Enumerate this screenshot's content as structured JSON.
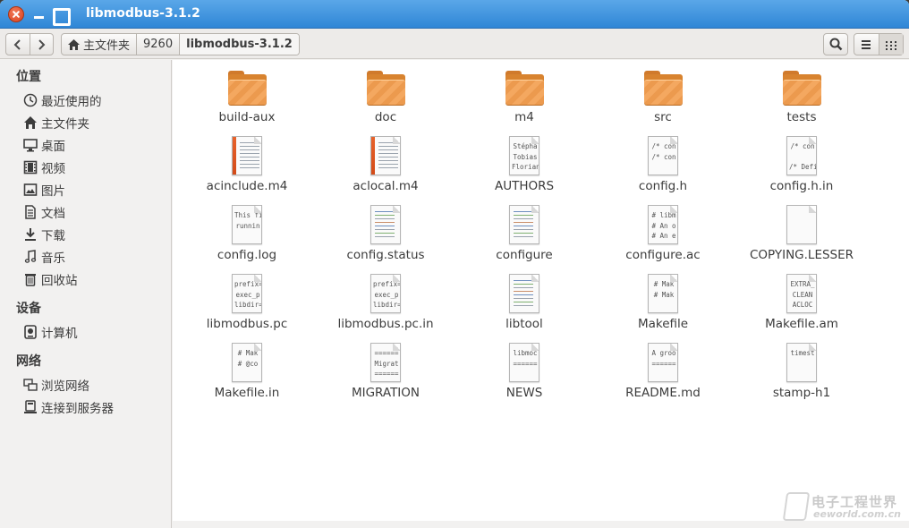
{
  "window": {
    "title": "libmodbus-3.1.2"
  },
  "toolbar": {
    "back_icon": "chevron-left-icon",
    "forward_icon": "chevron-right-icon",
    "breadcrumbs": [
      "主文件夹",
      "9260",
      "libmodbus-3.1.2"
    ],
    "search_icon": "search-icon",
    "list_view_icon": "list-view-icon",
    "grid_view_icon": "grid-view-icon"
  },
  "sidebar": {
    "sections": [
      {
        "title": "位置",
        "items": [
          {
            "label": "最近使用的",
            "icon": "clock-icon"
          },
          {
            "label": "主文件夹",
            "icon": "home-icon"
          },
          {
            "label": "桌面",
            "icon": "desktop-icon"
          },
          {
            "label": "视频",
            "icon": "film-icon"
          },
          {
            "label": "图片",
            "icon": "picture-icon"
          },
          {
            "label": "文档",
            "icon": "document-icon"
          },
          {
            "label": "下载",
            "icon": "download-icon"
          },
          {
            "label": "音乐",
            "icon": "music-note-icon"
          },
          {
            "label": "回收站",
            "icon": "trash-icon"
          }
        ]
      },
      {
        "title": "设备",
        "items": [
          {
            "label": "计算机",
            "icon": "drive-icon"
          }
        ]
      },
      {
        "title": "网络",
        "items": [
          {
            "label": "浏览网络",
            "icon": "network-icon"
          },
          {
            "label": "连接到服务器",
            "icon": "server-icon"
          }
        ]
      }
    ]
  },
  "files": [
    {
      "name": "build-aux",
      "kind": "folder"
    },
    {
      "name": "doc",
      "kind": "folder"
    },
    {
      "name": "m4",
      "kind": "folder"
    },
    {
      "name": "src",
      "kind": "folder"
    },
    {
      "name": "tests",
      "kind": "folder"
    },
    {
      "name": "acinclude.m4",
      "kind": "script"
    },
    {
      "name": "aclocal.m4",
      "kind": "script"
    },
    {
      "name": "AUTHORS",
      "kind": "text",
      "preview": "Stépha\nTobias\nFlorian"
    },
    {
      "name": "config.h",
      "kind": "text",
      "preview": "/* con\n/* con"
    },
    {
      "name": "config.h.in",
      "kind": "text",
      "preview": "/* con\n\n/* Defi"
    },
    {
      "name": "config.log",
      "kind": "text",
      "preview": "This fil\nrunnin"
    },
    {
      "name": "config.status",
      "kind": "code"
    },
    {
      "name": "configure",
      "kind": "code"
    },
    {
      "name": "configure.ac",
      "kind": "text",
      "preview": "# libm\n# An o\n# An e"
    },
    {
      "name": "COPYING.LESSER",
      "kind": "blank"
    },
    {
      "name": "libmodbus.pc",
      "kind": "text",
      "preview": "prefix=\nexec_p\nlibdir="
    },
    {
      "name": "libmodbus.pc.in",
      "kind": "text",
      "preview": "prefix=\nexec_p\nlibdir="
    },
    {
      "name": "libtool",
      "kind": "code"
    },
    {
      "name": "Makefile",
      "kind": "text",
      "preview": "# Mak\n# Mak"
    },
    {
      "name": "Makefile.am",
      "kind": "text",
      "preview": "EXTRA_\nCLEAN\nACLOC"
    },
    {
      "name": "Makefile.in",
      "kind": "text",
      "preview": "# Mak\n# @co"
    },
    {
      "name": "MIGRATION",
      "kind": "text",
      "preview": "======\nMigrat\n======"
    },
    {
      "name": "NEWS",
      "kind": "text",
      "preview": "libmoc\n======"
    },
    {
      "name": "README.md",
      "kind": "text",
      "preview": "A groo\n======"
    },
    {
      "name": "stamp-h1",
      "kind": "text",
      "preview": "timest"
    }
  ],
  "watermark": {
    "line1": "电子工程世界",
    "line2": "eeworld.com.cn"
  },
  "colors": {
    "titlebar": "#2f86d6",
    "close_button": "#d9401d",
    "folder": "#f4a860"
  }
}
